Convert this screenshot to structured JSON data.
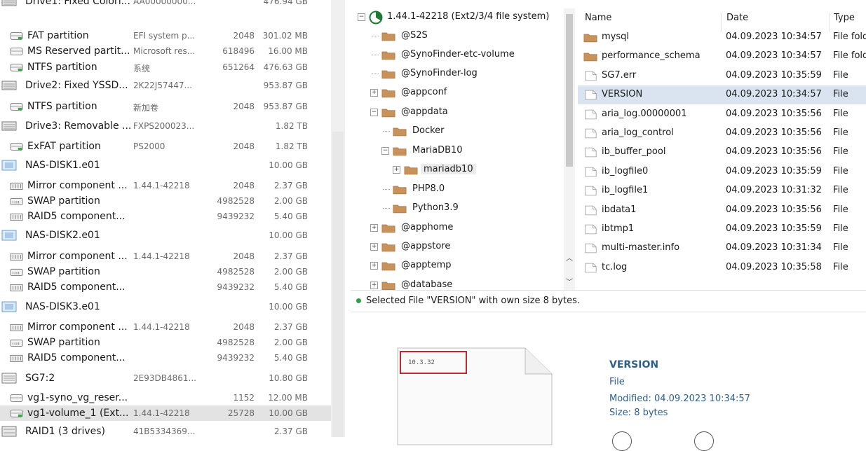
{
  "drives": [
    {
      "name": "Drive1: Fixed Colorf...",
      "info": "AA00000000...",
      "sectors": "",
      "size": "476.94 GB",
      "icon": "drive-icon",
      "level": 0
    },
    {
      "name": "FAT partition",
      "info": "EFI system p...",
      "sectors": "2048",
      "size": "301.02 MB",
      "icon": "partition-icon",
      "level": 1
    },
    {
      "name": "MS Reserved partit...",
      "info": "Microsoft res...",
      "sectors": "618496",
      "size": "16.00 MB",
      "icon": "partition-gray-icon",
      "level": 1
    },
    {
      "name": "NTFS partition",
      "info": "系统",
      "sectors": "651264",
      "size": "476.63 GB",
      "icon": "partition-icon",
      "level": 1
    },
    {
      "name": "Drive2: Fixed YSSD...",
      "info": "2K22J57447...",
      "sectors": "",
      "size": "953.87 GB",
      "icon": "drive-icon",
      "level": 0
    },
    {
      "name": "NTFS partition",
      "info": "新加卷",
      "sectors": "2048",
      "size": "953.87 GB",
      "icon": "partition-icon",
      "level": 1
    },
    {
      "name": "Drive3: Removable ...",
      "info": "FXPS200023...",
      "sectors": "",
      "size": "1.82 TB",
      "icon": "drive-icon",
      "level": 0
    },
    {
      "name": "ExFAT partition",
      "info": "PS2000",
      "sectors": "2048",
      "size": "1.82 TB",
      "icon": "partition-icon",
      "level": 1
    },
    {
      "name": "NAS-DISK1.e01",
      "info": "",
      "sectors": "",
      "size": "10.00 GB",
      "icon": "disk-image-icon",
      "level": 0
    },
    {
      "name": "Mirror component ...",
      "info": "1.44.1-42218",
      "sectors": "2048",
      "size": "2.37 GB",
      "icon": "raid-component-icon",
      "level": 1
    },
    {
      "name": "SWAP partition",
      "info": "",
      "sectors": "4982528",
      "size": "2.00 GB",
      "icon": "swap-icon",
      "level": 1
    },
    {
      "name": "RAID5 component...",
      "info": "",
      "sectors": "9439232",
      "size": "5.40 GB",
      "icon": "raid-component-icon",
      "level": 1
    },
    {
      "name": "NAS-DISK2.e01",
      "info": "",
      "sectors": "",
      "size": "10.00 GB",
      "icon": "disk-image-icon",
      "level": 0
    },
    {
      "name": "Mirror component ...",
      "info": "1.44.1-42218",
      "sectors": "2048",
      "size": "2.37 GB",
      "icon": "raid-component-icon",
      "level": 1
    },
    {
      "name": "SWAP partition",
      "info": "",
      "sectors": "4982528",
      "size": "2.00 GB",
      "icon": "swap-icon",
      "level": 1
    },
    {
      "name": "RAID5 component...",
      "info": "",
      "sectors": "9439232",
      "size": "5.40 GB",
      "icon": "raid-component-icon",
      "level": 1
    },
    {
      "name": "NAS-DISK3.e01",
      "info": "",
      "sectors": "",
      "size": "10.00 GB",
      "icon": "disk-image-icon",
      "level": 0
    },
    {
      "name": "Mirror component ...",
      "info": "1.44.1-42218",
      "sectors": "2048",
      "size": "2.37 GB",
      "icon": "raid-component-icon",
      "level": 1
    },
    {
      "name": "SWAP partition",
      "info": "",
      "sectors": "4982528",
      "size": "2.00 GB",
      "icon": "swap-icon",
      "level": 1
    },
    {
      "name": "RAID5 component...",
      "info": "",
      "sectors": "9439232",
      "size": "5.40 GB",
      "icon": "raid-component-icon",
      "level": 1
    },
    {
      "name": "SG7:2",
      "info": "2E93DB4861...",
      "sectors": "",
      "size": "10.80 GB",
      "icon": "volume-group-icon",
      "level": 0
    },
    {
      "name": "vg1-syno_vg_reser...",
      "info": "",
      "sectors": "1152",
      "size": "12.00 MB",
      "icon": "partition-gray-icon",
      "level": 1
    },
    {
      "name": "vg1-volume_1 (Ext...",
      "info": "1.44.1-42218",
      "sectors": "25728",
      "size": "10.00 GB",
      "icon": "partition-icon",
      "level": 1,
      "selected": true
    },
    {
      "name": "RAID1 (3 drives)",
      "info": "41B5334369...",
      "sectors": "",
      "size": "2.37 GB",
      "icon": "raid-icon",
      "level": 0
    }
  ],
  "tree": {
    "root_label": "1.44.1-42218 (Ext2/3/4 file system)",
    "items": [
      {
        "label": "@S2S",
        "expander": "none",
        "depth": 1
      },
      {
        "label": "@SynoFinder-etc-volume",
        "expander": "none",
        "depth": 1
      },
      {
        "label": "@SynoFinder-log",
        "expander": "none",
        "depth": 1
      },
      {
        "label": "@appconf",
        "expander": "+",
        "depth": 1
      },
      {
        "label": "@appdata",
        "expander": "−",
        "depth": 1
      },
      {
        "label": "Docker",
        "expander": "none",
        "depth": 2
      },
      {
        "label": "MariaDB10",
        "expander": "−",
        "depth": 2
      },
      {
        "label": "mariadb10",
        "expander": "+",
        "depth": 3,
        "selected": true
      },
      {
        "label": "PHP8.0",
        "expander": "none",
        "depth": 2
      },
      {
        "label": "Python3.9",
        "expander": "none",
        "depth": 2
      },
      {
        "label": "@apphome",
        "expander": "+",
        "depth": 1
      },
      {
        "label": "@appstore",
        "expander": "+",
        "depth": 1
      },
      {
        "label": "@apptemp",
        "expander": "+",
        "depth": 1
      },
      {
        "label": "@database",
        "expander": "+",
        "depth": 1
      }
    ]
  },
  "file_list": {
    "headers": {
      "name": "Name",
      "date": "Date",
      "type": "Type"
    },
    "rows": [
      {
        "name": "mysql",
        "date": "04.09.2023 10:34:57",
        "type": "File fold",
        "kind": "folder"
      },
      {
        "name": "performance_schema",
        "date": "04.09.2023 10:34:57",
        "type": "File fold",
        "kind": "folder"
      },
      {
        "name": "SG7.err",
        "date": "04.09.2023 10:35:59",
        "type": "File",
        "kind": "file"
      },
      {
        "name": "VERSION",
        "date": "04.09.2023 10:34:57",
        "type": "File",
        "kind": "file",
        "selected": true
      },
      {
        "name": "aria_log.00000001",
        "date": "04.09.2023 10:35:56",
        "type": "File",
        "kind": "file"
      },
      {
        "name": "aria_log_control",
        "date": "04.09.2023 10:35:56",
        "type": "File",
        "kind": "file"
      },
      {
        "name": "ib_buffer_pool",
        "date": "04.09.2023 10:35:56",
        "type": "File",
        "kind": "file"
      },
      {
        "name": "ib_logfile0",
        "date": "04.09.2023 10:35:59",
        "type": "File",
        "kind": "file"
      },
      {
        "name": "ib_logfile1",
        "date": "04.09.2023 10:31:32",
        "type": "File",
        "kind": "file"
      },
      {
        "name": "ibdata1",
        "date": "04.09.2023 10:35:56",
        "type": "File",
        "kind": "file"
      },
      {
        "name": "ibtmp1",
        "date": "04.09.2023 10:35:59",
        "type": "File",
        "kind": "file"
      },
      {
        "name": "multi-master.info",
        "date": "04.09.2023 10:31:34",
        "type": "File",
        "kind": "file"
      },
      {
        "name": "tc.log",
        "date": "04.09.2023 10:35:58",
        "type": "File",
        "kind": "file"
      }
    ]
  },
  "status": {
    "text": "Selected File \"VERSION\" with own size 8 bytes."
  },
  "preview": {
    "content": "10.3.32",
    "name": "VERSION",
    "kind": "File",
    "modified": "Modified: 04.09.2023 10:34:57",
    "size": "Size: 8 bytes"
  },
  "colors": {
    "accent": "#2d5f8a",
    "selection": "#d9e4f0",
    "highlight_box": "#c3282e",
    "status_ok": "#2ea043",
    "folder": "#c8935a"
  }
}
